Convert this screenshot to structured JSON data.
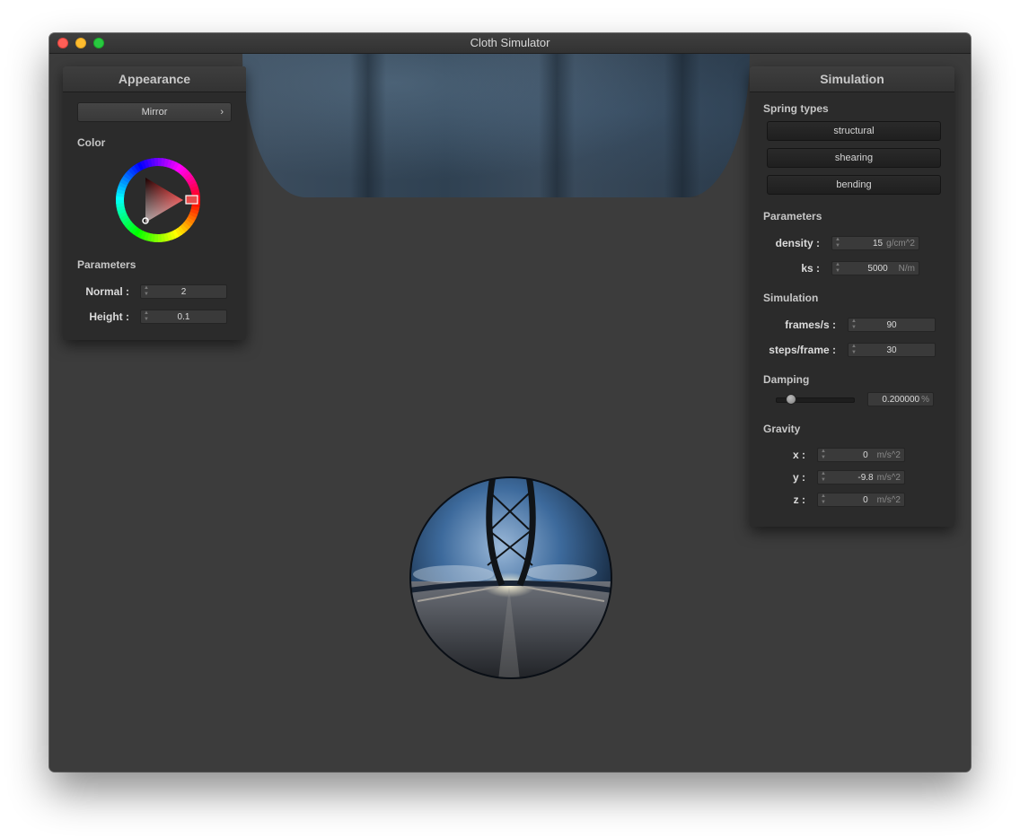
{
  "window": {
    "title": "Cloth Simulator"
  },
  "appearance": {
    "title": "Appearance",
    "shader_dropdown": {
      "value": "Mirror",
      "chevron": "›"
    },
    "color_label": "Color",
    "selected_color": "#e61c1c",
    "parameters_label": "Parameters",
    "normal": {
      "label": "Normal :",
      "value": "2"
    },
    "height": {
      "label": "Height :",
      "value": "0.1"
    }
  },
  "simulation": {
    "title": "Simulation",
    "spring_types_label": "Spring types",
    "spring_buttons": [
      "structural",
      "shearing",
      "bending"
    ],
    "parameters_label": "Parameters",
    "density": {
      "label": "density :",
      "value": "15",
      "unit": "g/cm^2"
    },
    "ks": {
      "label": "ks :",
      "value": "5000",
      "unit": "N/m"
    },
    "simulation_label": "Simulation",
    "frames": {
      "label": "frames/s :",
      "value": "90"
    },
    "steps": {
      "label": "steps/frame :",
      "value": "30"
    },
    "damping_label": "Damping",
    "damping": {
      "value": "0.200000",
      "unit": "%",
      "slider_fraction": 0.2
    },
    "gravity_label": "Gravity",
    "gravity": {
      "x": {
        "label": "x :",
        "value": "0",
        "unit": "m/s^2"
      },
      "y": {
        "label": "y :",
        "value": "-9.8",
        "unit": "m/s^2"
      },
      "z": {
        "label": "z :",
        "value": "0",
        "unit": "m/s^2"
      }
    }
  },
  "colors": {
    "panel_bg": "#2b2b2b",
    "viewport_bg": "#3c3c3c"
  }
}
